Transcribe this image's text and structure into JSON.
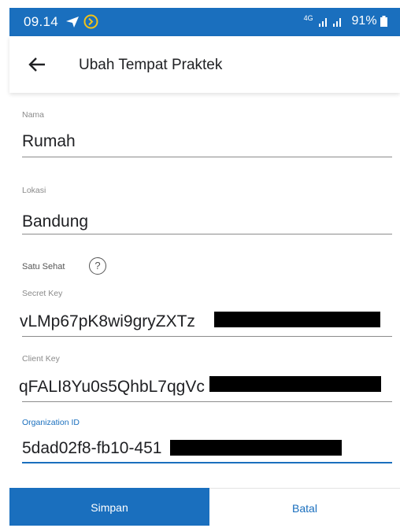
{
  "status_bar": {
    "time": "09.14",
    "network": "4G",
    "battery": "91%"
  },
  "header": {
    "title": "Ubah Tempat Praktek"
  },
  "form": {
    "nama": {
      "label": "Nama",
      "value": "Rumah"
    },
    "lokasi": {
      "label": "Lokasi",
      "value": "Bandung"
    },
    "satu_sehat": {
      "label": "Satu Sehat",
      "help": "?"
    },
    "secret_key": {
      "label": "Secret Key",
      "value": "vLMp67pK8wi9gryZXTz"
    },
    "client_key": {
      "label": "Client Key",
      "value": "qFALI8Yu0s5QhbL7qgVc"
    },
    "organization_id": {
      "label": "Organization ID",
      "value": "5dad02f8-fb10-451"
    }
  },
  "actions": {
    "save_label": "Simpan",
    "cancel_label": "Batal"
  },
  "colors": {
    "primary": "#1a6fbe",
    "text": "#202124",
    "redaction": "#000000"
  },
  "icons": {
    "back": "arrow-left-icon",
    "help": "question-circle-icon",
    "navigation": "navigation-arrow-icon",
    "battery": "battery-icon"
  }
}
